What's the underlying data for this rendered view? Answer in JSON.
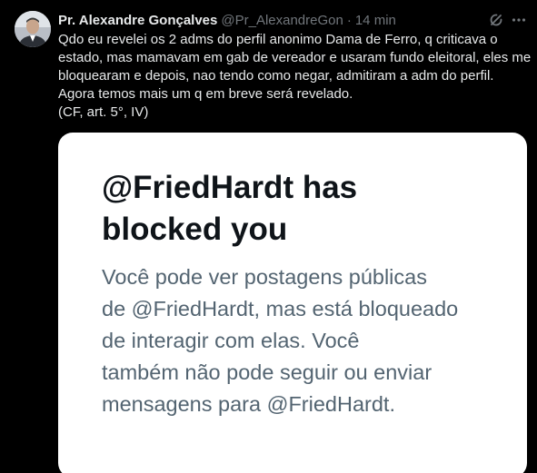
{
  "tweet": {
    "author": {
      "display_name": "Pr. Alexandre Gonçalves",
      "handle": "@Pr_AlexandreGon",
      "separator": "·",
      "time": "14 min"
    },
    "icons": {
      "avatar": "avatar",
      "grok": "grok-icon",
      "more": "more-icon"
    },
    "text_lines": [
      "Qdo eu revelei os 2 adms do perfil anonimo Dama de Ferro, q criticava o",
      "estado, mas mamavam em gab de vereador e usaram fundo eleitoral, eles me",
      "bloquearam e depois, nao tendo como negar, admitiram a adm do perfil.",
      "Agora temos mais um q em breve será revelado.",
      "(CF, art. 5°, IV)"
    ],
    "media": {
      "title_lines": [
        "@FriedHardt has",
        "blocked you"
      ],
      "body_lines": [
        "Você pode ver postagens públicas",
        "de @FriedHardt, mas está bloqueado",
        "de interagir com elas. Você",
        "também não pode seguir ou enviar",
        "mensagens para @FriedHardt."
      ]
    }
  },
  "colors": {
    "background": "#000000",
    "primary_text": "#e7e9ea",
    "secondary_text": "#71767b",
    "card_background": "#ffffff",
    "card_title": "#0f1419",
    "card_body": "#536471"
  }
}
